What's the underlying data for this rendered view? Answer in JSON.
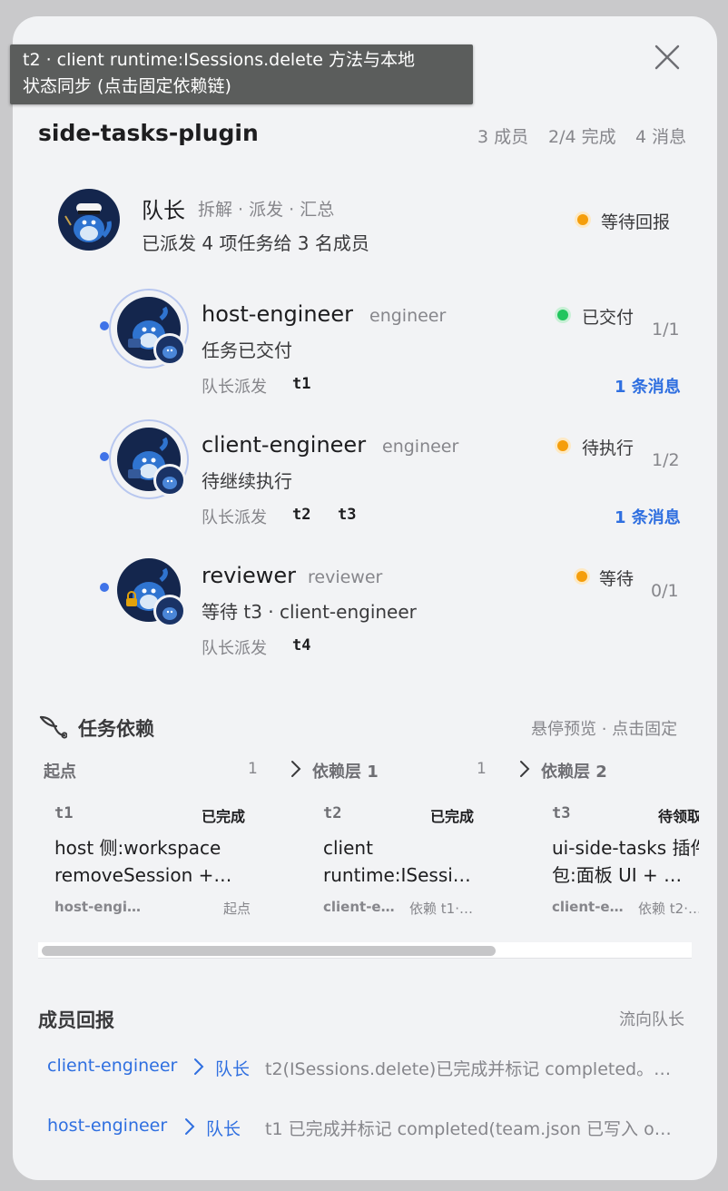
{
  "tooltip": {
    "line1": "t2 · client runtime:ISessions.delete 方法与本地",
    "line2": "状态同步 (点击固定依赖链)"
  },
  "team": {
    "name": "side-tasks-plugin",
    "members": "3 成员",
    "progress": "2/4 完成",
    "messages": "4 消息"
  },
  "leader": {
    "name": "队长",
    "role": "拆解 · 派发 · 汇总",
    "desc": "已派发 4 项任务给 3 名成员",
    "status": "等待回报",
    "status_color": "#f59e0b"
  },
  "members": [
    {
      "name": "host-engineer",
      "role": "engineer",
      "desc": "任务已交付",
      "status": "已交付",
      "status_color": "#22c55e",
      "count": "1/1",
      "assigned_label": "队长派发",
      "tasks": [
        "t1"
      ],
      "messages_link": "1 条消息"
    },
    {
      "name": "client-engineer",
      "role": "engineer",
      "desc": "待继续执行",
      "status": "待执行",
      "status_color": "#f59e0b",
      "count": "1/2",
      "assigned_label": "队长派发",
      "tasks": [
        "t2",
        "t3"
      ],
      "messages_link": "1 条消息"
    },
    {
      "name": "reviewer",
      "role": "reviewer",
      "desc": "等待 t3 · client-engineer",
      "status": "等待",
      "status_color": "#f59e0b",
      "count": "0/1",
      "assigned_label": "队长派发",
      "tasks": [
        "t4"
      ],
      "messages_link": ""
    }
  ],
  "deps": {
    "title": "任务依赖",
    "hint": "悬停预览 · 点击固定",
    "columns": [
      {
        "label": "起点",
        "count": "1"
      },
      {
        "label": "依赖层 1",
        "count": "1"
      },
      {
        "label": "依赖层 2",
        "count": ""
      }
    ],
    "cards": [
      {
        "id": "t1",
        "status": "已完成",
        "text": "host 侧:workspace removeSession +…",
        "owner": "host-engi…",
        "dep": "起点"
      },
      {
        "id": "t2",
        "status": "已完成",
        "text": "client runtime:ISessi…",
        "owner": "client-e…",
        "dep": "依赖 t1·…"
      },
      {
        "id": "t3",
        "status": "待领取",
        "text": "ui-side-tasks 插件包:面板 UI + …",
        "owner": "client-e…",
        "dep": "依赖 t2·…"
      }
    ]
  },
  "reports": {
    "title": "成员回报",
    "hint": "流向队长",
    "items": [
      {
        "from": "client-engineer",
        "to": "队长",
        "text": "t2(ISessions.delete)已完成并标记 completed。…"
      },
      {
        "from": "host-engineer",
        "to": "队长",
        "text": "t1 已完成并标记 completed(team.json 已写入 o…"
      }
    ]
  },
  "icons": {
    "close": "close-icon",
    "deps": "branch-icon",
    "chevron": "chevron-right-icon",
    "lock": "lock-icon"
  }
}
